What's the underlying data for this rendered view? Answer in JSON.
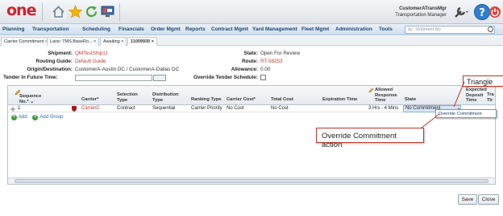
{
  "header": {
    "logo": "one",
    "user_name": "CustomerATransMgr",
    "user_role": "Transportation Manager"
  },
  "nav": {
    "items": [
      "Planning",
      "Transportation",
      "Scheduling",
      "Financials",
      "Order Mgmt",
      "Reports",
      "Contract Mgmt",
      "Yard Management",
      "Fleet Mgmt",
      "Administration",
      "Tools"
    ],
    "search_placeholder": "by: Shipment No"
  },
  "tabs": [
    {
      "label": "Carrier Commitment ×"
    },
    {
      "label": "Lane: TMS.BaseRo... ×"
    },
    {
      "label": "Awaiting ×"
    },
    {
      "label": "11009930 ×"
    }
  ],
  "form": {
    "shipment_label": "Shipment:",
    "shipment_value": "QMTestShip11",
    "routing_label": "Routing Guide:",
    "routing_value": "Default Guide",
    "origin_label": "Origin/Destination:",
    "origin_value": "CustomerA-Austin DC / CustomerA-Dallas DC",
    "tender_label": "Tender In Future Time:",
    "state_label": "State:",
    "state_value": "Open For Review",
    "route_label": "Route:",
    "route_value": "RT-58253",
    "allowance_label": "Allowance:",
    "allowance_value": "0.00",
    "override_label": "Override Tender Schedule:"
  },
  "grid": {
    "headers": {
      "sequence": "Sequence No.* ⌄",
      "carrier": "Carrier*",
      "selection": "Selection Type",
      "distribution": "Distribution Type",
      "ranking": "Ranking Type",
      "carrier_cost": "Carrier Cost*",
      "total_cost": "Total Cost",
      "expiration": "Expiration Time",
      "allowed": "Allowed Response Time",
      "state": "State",
      "expected": "Expected Deposit Time",
      "tr": "Tra Tir"
    },
    "row": {
      "seq": "1",
      "carrier": "CarrierC",
      "selection": "Contract",
      "distribution": "Sequential",
      "ranking": "Carrier Priority",
      "carrier_cost": "No Cost",
      "total_cost": "No Cost",
      "allowed": "3 Hrs - 4 Mins",
      "state": "No Commitment"
    },
    "add_label": "Add",
    "add_group_label": "Add Group"
  },
  "popup": {
    "label": "Override Commitment"
  },
  "callouts": {
    "triangle": "Triangle",
    "override": "Override Commitment action"
  },
  "buttons": {
    "save": "Save",
    "close": "Close"
  },
  "colors": {
    "brand_red": "#d61f2c",
    "nav_text": "#21476e",
    "callout_border": "#c0392b"
  }
}
